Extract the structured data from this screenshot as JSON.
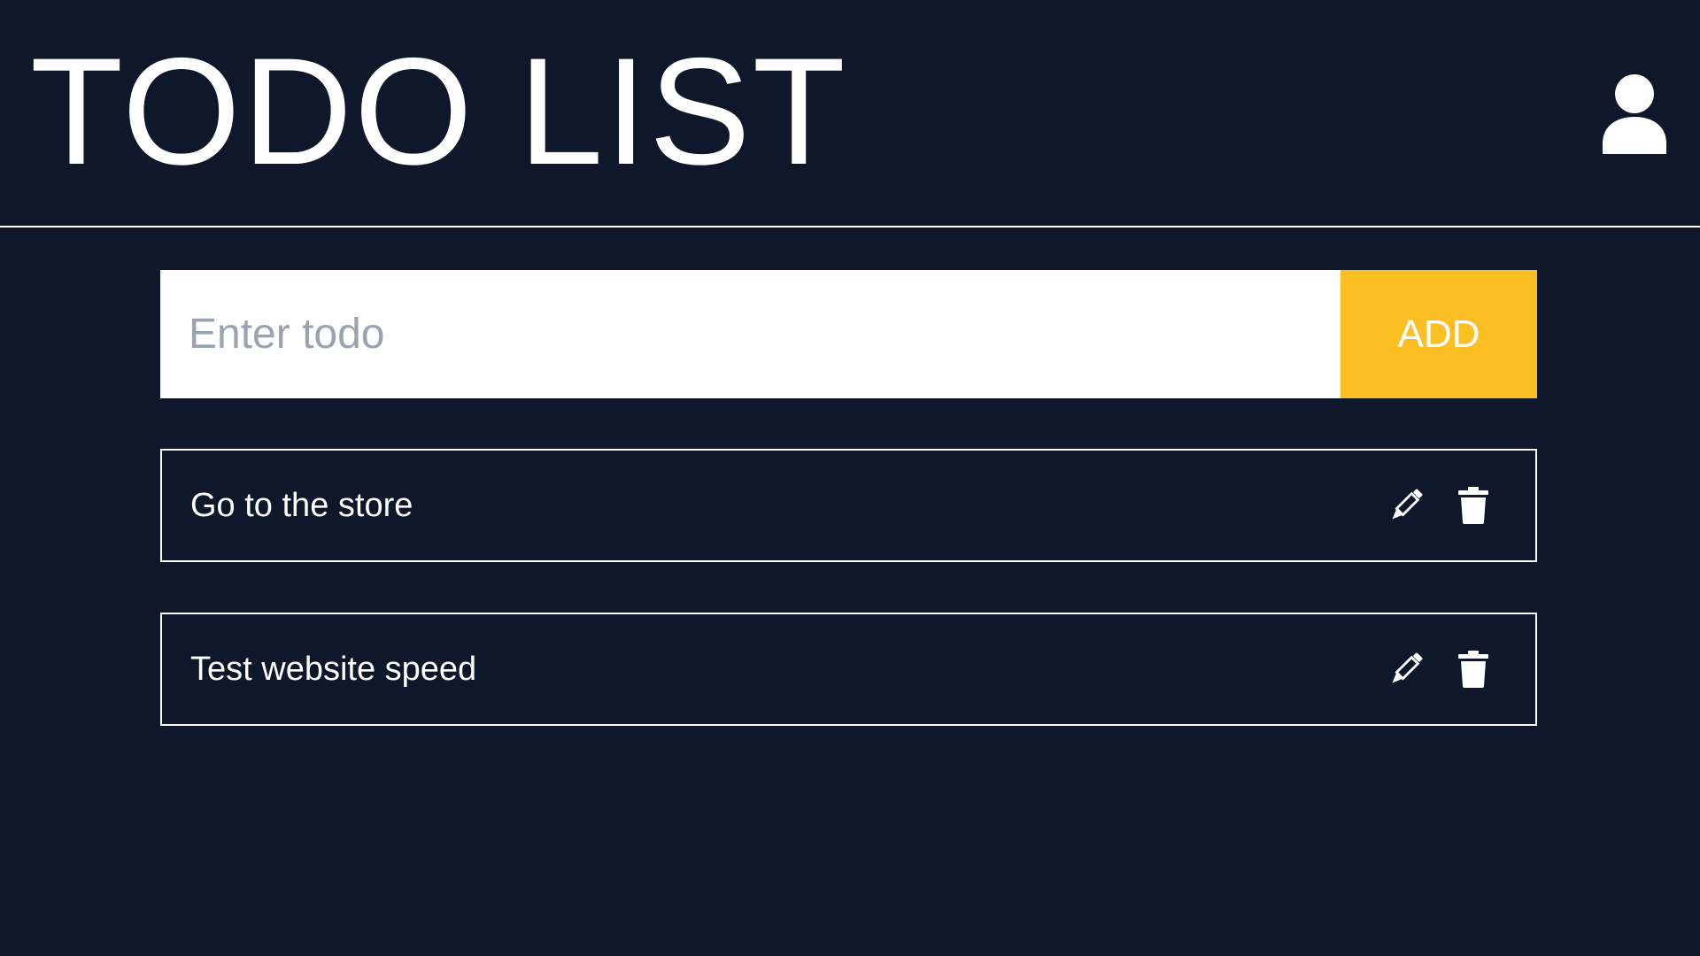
{
  "header": {
    "title": "TODO LIST",
    "user_icon": "user-icon"
  },
  "form": {
    "input_value": "",
    "placeholder": "Enter todo",
    "add_label": "ADD"
  },
  "todos": [
    {
      "text": "Go to the store",
      "edit_icon": "pencil-icon",
      "delete_icon": "trash-icon"
    },
    {
      "text": "Test website speed",
      "edit_icon": "pencil-icon",
      "delete_icon": "trash-icon"
    }
  ],
  "colors": {
    "background": "#0f172a",
    "accent": "#fbbf24",
    "text": "#ffffff",
    "placeholder": "#9ca3af"
  }
}
